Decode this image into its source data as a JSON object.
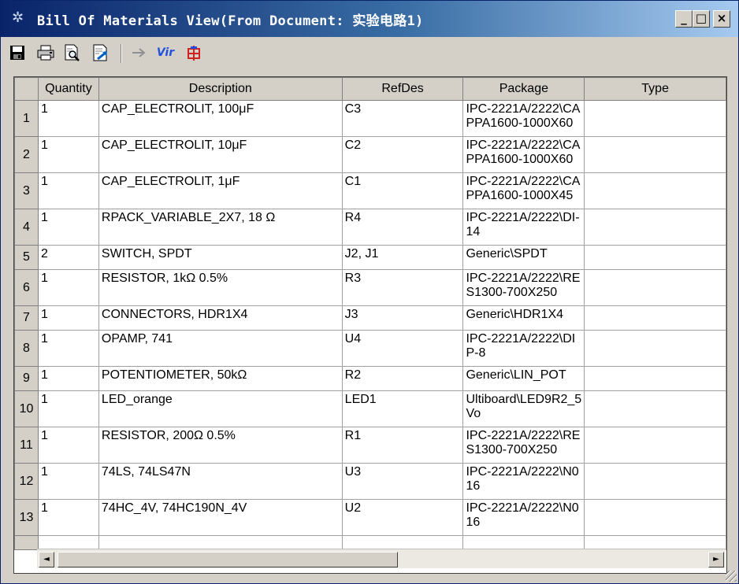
{
  "window": {
    "title": "Bill Of Materials View(From Document: 实验电路1)",
    "controls": {
      "minimize": "_",
      "maximize": "□",
      "close": "×"
    }
  },
  "toolbar": {
    "icons": [
      "save-icon",
      "print-icon",
      "print-preview-icon",
      "export-icon",
      "arrow-icon",
      "virtual-icon",
      "component-icon"
    ],
    "vir_label": "Vir"
  },
  "table": {
    "columns": [
      "Quantity",
      "Description",
      "RefDes",
      "Package",
      "Type"
    ],
    "rows": [
      {
        "num": "1",
        "quantity": "1",
        "description": "CAP_ELECTROLIT, 100μF",
        "refdes": "C3",
        "package": "IPC-2221A/2222\\CAPPA1600-1000X60",
        "type": ""
      },
      {
        "num": "2",
        "quantity": "1",
        "description": "CAP_ELECTROLIT, 10μF",
        "refdes": "C2",
        "package": "IPC-2221A/2222\\CAPPA1600-1000X60",
        "type": ""
      },
      {
        "num": "3",
        "quantity": "1",
        "description": "CAP_ELECTROLIT, 1μF",
        "refdes": "C1",
        "package": "IPC-2221A/2222\\CAPPA1600-1000X45",
        "type": ""
      },
      {
        "num": "4",
        "quantity": "1",
        "description": "RPACK_VARIABLE_2X7, 18 Ω",
        "refdes": "R4",
        "package": "IPC-2221A/2222\\DI-14",
        "type": ""
      },
      {
        "num": "5",
        "quantity": "2",
        "description": "SWITCH, SPDT",
        "refdes": "J2, J1",
        "package": "Generic\\SPDT",
        "type": ""
      },
      {
        "num": "6",
        "quantity": "1",
        "description": "RESISTOR, 1kΩ 0.5%",
        "refdes": "R3",
        "package": "IPC-2221A/2222\\RES1300-700X250",
        "type": ""
      },
      {
        "num": "7",
        "quantity": "1",
        "description": "CONNECTORS, HDR1X4",
        "refdes": "J3",
        "package": "Generic\\HDR1X4",
        "type": ""
      },
      {
        "num": "8",
        "quantity": "1",
        "description": "OPAMP, 741",
        "refdes": "U4",
        "package": "IPC-2221A/2222\\DIP-8",
        "type": ""
      },
      {
        "num": "9",
        "quantity": "1",
        "description": "POTENTIOMETER, 50kΩ",
        "refdes": "R2",
        "package": "Generic\\LIN_POT",
        "type": ""
      },
      {
        "num": "10",
        "quantity": "1",
        "description": "LED_orange",
        "refdes": "LED1",
        "package": "Ultiboard\\LED9R2_5Vo",
        "type": ""
      },
      {
        "num": "11",
        "quantity": "1",
        "description": "RESISTOR, 200Ω 0.5%",
        "refdes": "R1",
        "package": "IPC-2221A/2222\\RES1300-700X250",
        "type": ""
      },
      {
        "num": "12",
        "quantity": "1",
        "description": "74LS, 74LS47N",
        "refdes": "U3",
        "package": "IPC-2221A/2222\\N016",
        "type": ""
      },
      {
        "num": "13",
        "quantity": "1",
        "description": "74HC_4V, 74HC190N_4V",
        "refdes": "U2",
        "package": "IPC-2221A/2222\\N016",
        "type": ""
      }
    ]
  },
  "scrollbar": {
    "left_arrow": "◄",
    "right_arrow": "►"
  }
}
